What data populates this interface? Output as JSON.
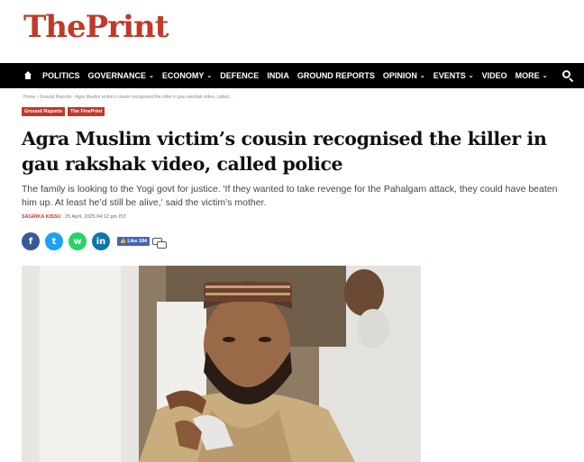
{
  "site": {
    "logo_the": "The",
    "logo_print": "Print"
  },
  "nav": {
    "items": [
      {
        "label": "POLITICS",
        "dropdown": false
      },
      {
        "label": "GOVERNANCE",
        "dropdown": true
      },
      {
        "label": "ECONOMY",
        "dropdown": true
      },
      {
        "label": "DEFENCE",
        "dropdown": false
      },
      {
        "label": "INDIA",
        "dropdown": false
      },
      {
        "label": "GROUND REPORTS",
        "dropdown": false
      },
      {
        "label": "OPINION",
        "dropdown": true
      },
      {
        "label": "EVENTS",
        "dropdown": true
      },
      {
        "label": "VIDEO",
        "dropdown": false
      },
      {
        "label": "MORE",
        "dropdown": true
      }
    ],
    "caret": "⌄"
  },
  "breadcrumb": "Home  ›  Ground Reports  ›  Agra Muslim victim's cousin recognised the killer in gau rakshak video, called...",
  "tags": [
    "Ground Reports",
    "The FinePrint"
  ],
  "article": {
    "headline": "Agra Muslim victim’s cousin recognised the killer in gau rakshak video, called police",
    "subhead": "The family is looking to the Yogi govt for justice. 'If they wanted to take revenge for the Pahalgam attack, they could have beaten him up. At least he’d still be alive,' said the victim’s mother.",
    "author": "SAGRIKA KISSU",
    "date": "25 April, 2025 04:12 pm IST"
  },
  "share": {
    "facebook_glyph": "f",
    "twitter_glyph": "t",
    "whatsapp_glyph": "w",
    "linkedin_glyph": "in",
    "like_label": "👍 Like 184"
  },
  "colors": {
    "brand": "#c0392b",
    "nav_bg": "#000000"
  }
}
